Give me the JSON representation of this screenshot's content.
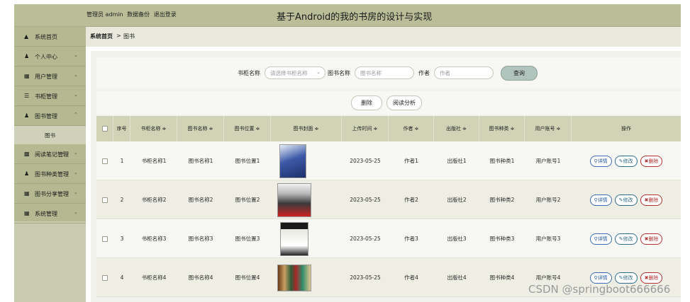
{
  "header": {
    "admin_text": "管理员 admin",
    "backup_link": "数据备份",
    "logout_link": "退出登录",
    "title": "基于Android的我的书房的设计与实现"
  },
  "sidebar": {
    "items": [
      {
        "icon": "home-icon",
        "label": "系统首页",
        "expandable": false
      },
      {
        "icon": "user-icon",
        "label": "个人中心",
        "expandable": true
      },
      {
        "icon": "grid-icon",
        "label": "用户管理",
        "expandable": true
      },
      {
        "icon": "list-icon",
        "label": "书柜管理",
        "expandable": true
      },
      {
        "icon": "user-icon",
        "label": "图书管理",
        "expandable": true,
        "expanded": true
      },
      {
        "icon": "chart-icon",
        "label": "阅读笔记管理",
        "expandable": true
      },
      {
        "icon": "user-icon",
        "label": "图书种类管理",
        "expandable": true
      },
      {
        "icon": "grid-icon",
        "label": "图书分享管理",
        "expandable": true
      },
      {
        "icon": "table-icon",
        "label": "系统管理",
        "expandable": true
      }
    ],
    "sub_item": "图书"
  },
  "breadcrumb": {
    "home": "系统首页",
    "separator": ">",
    "current": "图书"
  },
  "search": {
    "cabinet_label": "书柜名称",
    "cabinet_placeholder": "请选择书柜名称",
    "book_label": "图书名称",
    "book_placeholder": "图书名称",
    "author_label": "作者",
    "author_placeholder": "作者",
    "query_button": "查询"
  },
  "toolbar": {
    "delete_button": "删除",
    "analysis_button": "阅读分析"
  },
  "table": {
    "headers": {
      "index": "序号",
      "cabinet": "书柜名称 ≑",
      "book_name": "图书名称 ≑",
      "location": "图书位置 ≑",
      "cover": "图书封面 ≑",
      "upload_time": "上传时间 ≑",
      "author": "作者 ≑",
      "publisher": "出版社 ≑",
      "category": "图书种类 ≑",
      "account": "用户账号 ≑",
      "actions": "操作"
    },
    "rows": [
      {
        "index": "1",
        "cabinet": "书柜名称1",
        "book_name": "图书名称1",
        "location": "图书位置1",
        "upload_time": "2023-05-25",
        "author": "作者1",
        "publisher": "出版社1",
        "category": "图书种类1",
        "account": "用户账号1"
      },
      {
        "index": "2",
        "cabinet": "书柜名称2",
        "book_name": "图书名称2",
        "location": "图书位置2",
        "upload_time": "2023-05-25",
        "author": "作者2",
        "publisher": "出版社2",
        "category": "图书种类2",
        "account": "用户账号2"
      },
      {
        "index": "3",
        "cabinet": "书柜名称3",
        "book_name": "图书名称3",
        "location": "图书位置3",
        "upload_time": "2023-05-25",
        "author": "作者3",
        "publisher": "出版社3",
        "category": "图书种类3",
        "account": "用户账号3"
      },
      {
        "index": "4",
        "cabinet": "书柜名称4",
        "book_name": "图书名称4",
        "location": "图书位置4",
        "upload_time": "2023-05-25",
        "author": "作者4",
        "publisher": "出版社4",
        "category": "图书种类4",
        "account": "用户账号4"
      }
    ],
    "actions": {
      "detail": "详情",
      "edit": "修改",
      "delete": "删除"
    }
  },
  "watermark": "CSDN @springboot666666",
  "colors": {
    "header_bg": "#b9bd98",
    "sidebar_bg": "#b5b992",
    "table_header_bg": "#d0d3b6",
    "query_button_bg": "#b0c3bc",
    "detail_color": "#2a5aa0",
    "edit_color": "#2f6b8a",
    "delete_color": "#b03030"
  }
}
